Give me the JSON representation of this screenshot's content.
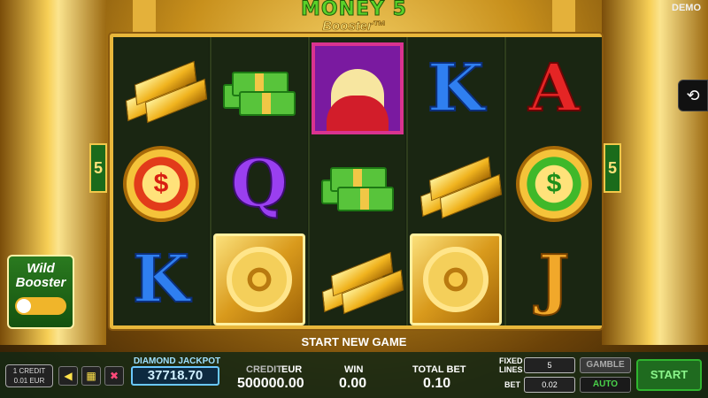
{
  "game": {
    "logo_line1": "MONEY 5",
    "logo_line2": "Booster™",
    "mode": "DEMO"
  },
  "reels": {
    "columns": [
      [
        "gold-bars",
        "scatter-red",
        "letter-K"
      ],
      [
        "cash-stack",
        "letter-Q",
        "vault"
      ],
      [
        "blonde",
        "cash-stack",
        "gold-bars"
      ],
      [
        "letter-K",
        "gold-bars",
        "vault"
      ],
      [
        "letter-A",
        "scatter-green",
        "letter-J"
      ]
    ],
    "letters": {
      "K": "K",
      "Q": "Q",
      "A": "A",
      "J": "J"
    },
    "scatter_text": "$",
    "line_marker_left": "5",
    "line_marker_right": "5"
  },
  "wild_booster": {
    "title_line1": "Wild",
    "title_line2": "Booster",
    "enabled": false
  },
  "status_text": "START NEW GAME",
  "bottom": {
    "credit_line1": "1 CREDIT",
    "credit_line2": "0.01 EUR",
    "jackpot_label": "DIAMOND JACKPOT",
    "jackpot_value": "37718.70",
    "credit_label": "CREDIT",
    "currency": "EUR",
    "credit_value": "500000.00",
    "win_label": "WIN",
    "win_value": "0.00",
    "total_bet_label": "TOTAL BET",
    "total_bet_value": "0.10",
    "fixed_lines_label_1": "FIXED",
    "fixed_lines_label_2": "LINES",
    "fixed_lines_value": "5",
    "bet_label": "BET",
    "bet_value": "0.02",
    "gamble_label": "GAMBLE",
    "auto_label": "AUTO",
    "start_label": "START"
  },
  "icons": {
    "history": "history-icon",
    "sound": "speaker-icon",
    "close": "close-x-icon"
  },
  "colors": {
    "frame_gold": "#e9b73b",
    "jackpot_blue": "#6ac8ff",
    "start_green": "#2fb52f"
  }
}
